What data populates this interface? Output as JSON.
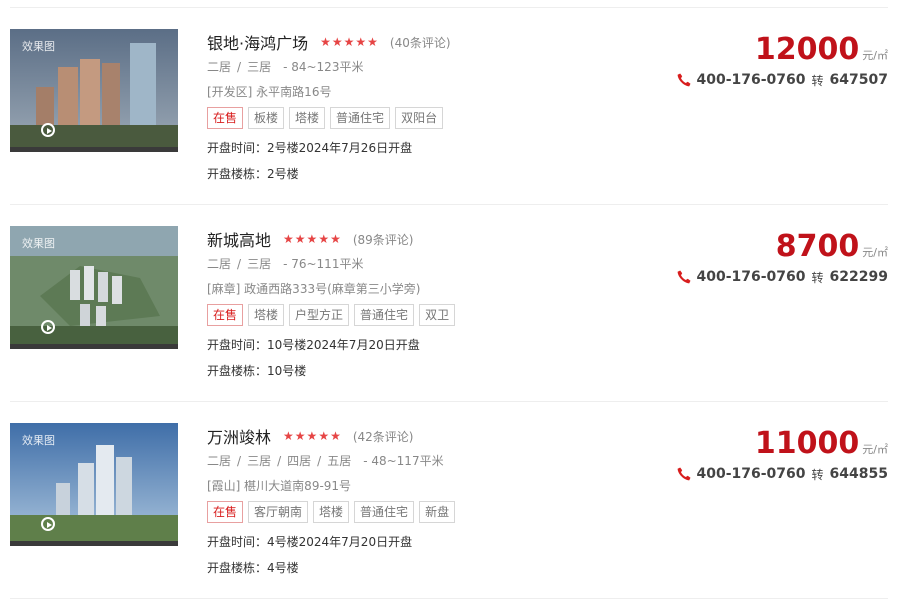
{
  "listings": [
    {
      "thumb_tag": "效果图",
      "name": "银地·海鸿广场",
      "stars": 5,
      "reviews": "(40条评论)",
      "rooms": [
        "二居",
        "三居"
      ],
      "area": "- 84~123平米",
      "address": "[开发区] 永平南路16号",
      "tags": [
        {
          "label": "在售",
          "highlight": true
        },
        {
          "label": "板楼",
          "highlight": false
        },
        {
          "label": "塔楼",
          "highlight": false
        },
        {
          "label": "普通住宅",
          "highlight": false
        },
        {
          "label": "双阳台",
          "highlight": false
        }
      ],
      "open_time": "开盘时间：2号楼2024年7月26日开盘",
      "open_building": "开盘楼栋：2号楼",
      "price": "12000",
      "unit": "元/㎡",
      "phone": "400-176-0760",
      "transfer": "转",
      "extension": "647507"
    },
    {
      "thumb_tag": "效果图",
      "name": "新城高地",
      "stars": 5,
      "reviews": "(89条评论)",
      "rooms": [
        "二居",
        "三居"
      ],
      "area": "- 76~111平米",
      "address": "[麻章] 政通西路333号(麻章第三小学旁)",
      "tags": [
        {
          "label": "在售",
          "highlight": true
        },
        {
          "label": "塔楼",
          "highlight": false
        },
        {
          "label": "户型方正",
          "highlight": false
        },
        {
          "label": "普通住宅",
          "highlight": false
        },
        {
          "label": "双卫",
          "highlight": false
        }
      ],
      "open_time": "开盘时间：10号楼2024年7月20日开盘",
      "open_building": "开盘楼栋：10号楼",
      "price": "8700",
      "unit": "元/㎡",
      "phone": "400-176-0760",
      "transfer": "转",
      "extension": "622299"
    },
    {
      "thumb_tag": "效果图",
      "name": "万洲竣林",
      "stars": 5,
      "reviews": "(42条评论)",
      "rooms": [
        "二居",
        "三居",
        "四居",
        "五居"
      ],
      "area": "- 48~117平米",
      "address": "[霞山] 椹川大道南89-91号",
      "tags": [
        {
          "label": "在售",
          "highlight": true
        },
        {
          "label": "客厅朝南",
          "highlight": false
        },
        {
          "label": "塔楼",
          "highlight": false
        },
        {
          "label": "普通住宅",
          "highlight": false
        },
        {
          "label": "新盘",
          "highlight": false
        }
      ],
      "open_time": "开盘时间：4号楼2024年7月20日开盘",
      "open_building": "开盘楼栋：4号楼",
      "price": "11000",
      "unit": "元/㎡",
      "phone": "400-176-0760",
      "transfer": "转",
      "extension": "644855"
    }
  ],
  "colors": {
    "price": "#c0121a",
    "star": "#e64545",
    "sale_tag": "#d81e1e",
    "phone_icon": "#d81e1e"
  },
  "icons": {
    "rating": "star-icon",
    "video": "play-icon",
    "contact": "phone-icon"
  }
}
